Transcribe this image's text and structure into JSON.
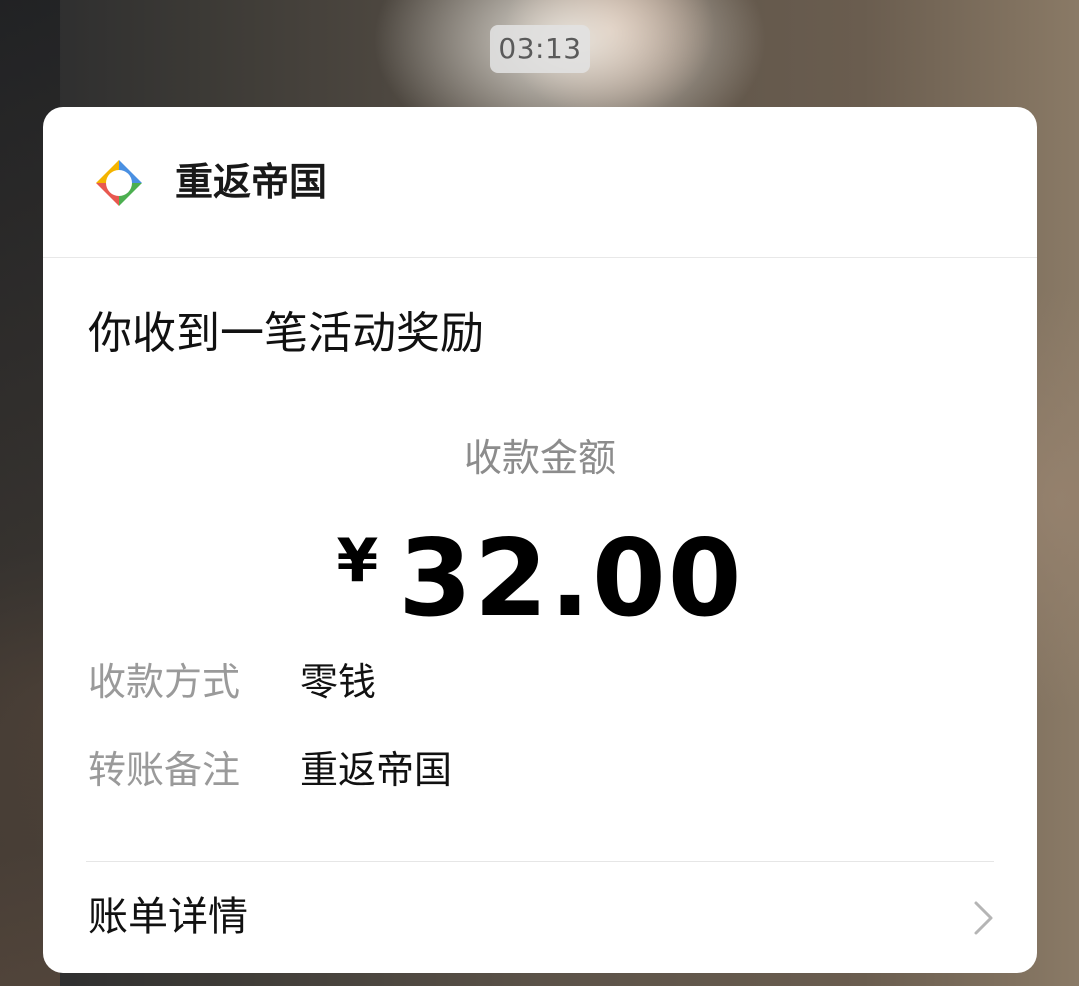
{
  "status": {
    "time": "03:13"
  },
  "card": {
    "app_name": "重返帝国",
    "title": "你收到一笔活动奖励",
    "amount_label": "收款金额",
    "currency": "¥",
    "amount": "32.00",
    "details": [
      {
        "key": "收款方式",
        "value": "零钱"
      },
      {
        "key": "转账备注",
        "value": "重返帝国"
      }
    ],
    "bill_details_label": "账单详情"
  },
  "colors": {
    "logo_yellow": "#F4B400",
    "logo_blue": "#4A90E2",
    "logo_red": "#E8584F",
    "logo_green": "#4CAF50",
    "muted_text": "#9a9a9a",
    "primary_text": "#111111"
  },
  "icons": {
    "app_logo": "app-logo-icon",
    "chevron": "chevron-right-icon"
  }
}
